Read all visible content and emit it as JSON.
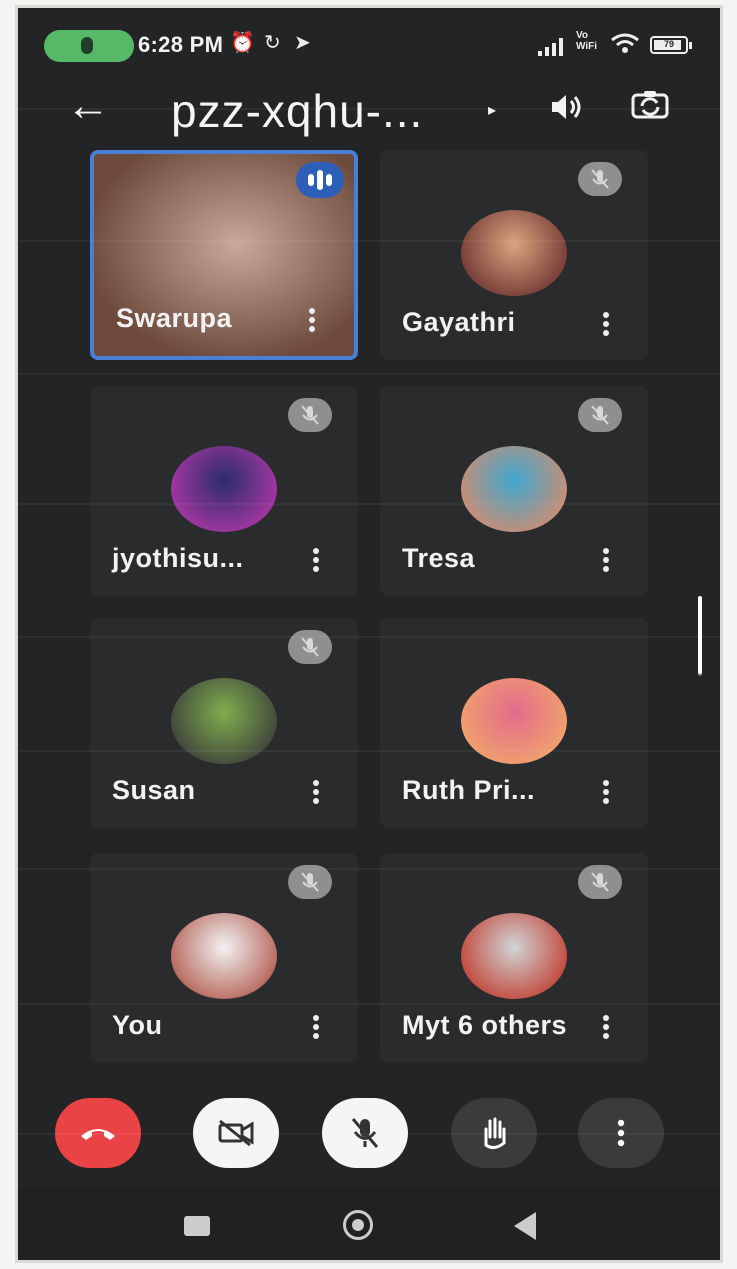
{
  "status_bar": {
    "time": "6:28 PM",
    "battery_label": "79",
    "volte_label": "Vo\nWiFi"
  },
  "app_bar": {
    "meeting_code": "pzz-xqhu-..."
  },
  "participants": [
    {
      "name": "Swarupa",
      "speaking": true,
      "muted": false,
      "avatar_colors": [
        "#c9a99a",
        "#6d4a3c"
      ]
    },
    {
      "name": "Gayathri",
      "speaking": false,
      "muted": true,
      "avatar_colors": [
        "#d9a57d",
        "#6a2f2f"
      ]
    },
    {
      "name": "jyothisu...",
      "speaking": false,
      "muted": true,
      "avatar_colors": [
        "#2b2d6b",
        "#b238a8"
      ]
    },
    {
      "name": "Tresa",
      "speaking": false,
      "muted": true,
      "avatar_colors": [
        "#3fa7cf",
        "#d98b6b"
      ]
    },
    {
      "name": "Susan",
      "speaking": false,
      "muted": true,
      "avatar_colors": [
        "#7fae4e",
        "#3a3a3a"
      ]
    },
    {
      "name": "Ruth Pri...",
      "speaking": false,
      "muted": false,
      "avatar_colors": [
        "#e46b8c",
        "#f1a76a"
      ]
    },
    {
      "name": "You",
      "speaking": false,
      "muted": true,
      "avatar_colors": [
        "#f2f2f2",
        "#b0574b"
      ]
    },
    {
      "name": "Myt 6 others",
      "speaking": false,
      "muted": true,
      "avatar_colors": [
        "#d1d4d6",
        "#c0392b"
      ]
    }
  ],
  "controls": {
    "hangup_color": "#ea4345",
    "icons": [
      "end-call-icon",
      "camera-off-icon",
      "mic-off-icon",
      "raise-hand-icon",
      "more-options-icon"
    ]
  },
  "colors": {
    "background": "#232425",
    "tile": "#2a2b2c",
    "active_border": "#4a7fd6",
    "mute_badge": "#8e8f91"
  }
}
